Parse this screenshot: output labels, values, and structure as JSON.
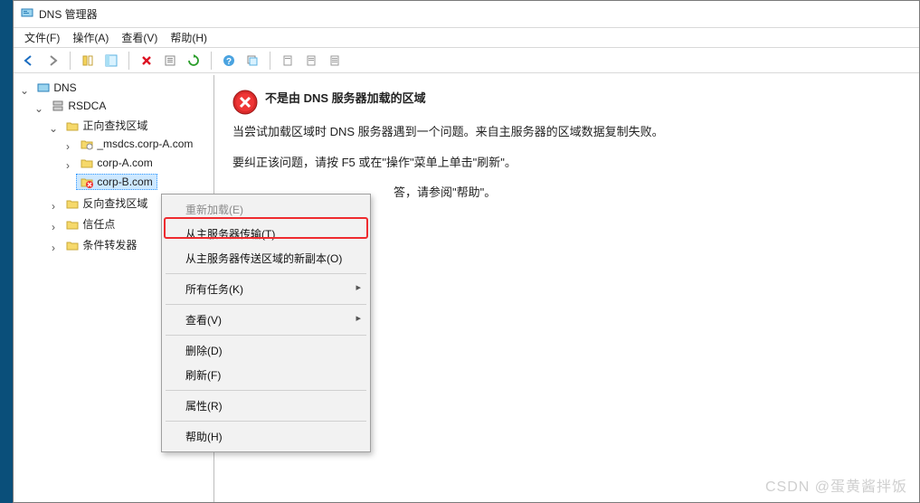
{
  "window": {
    "title": "DNS 管理器"
  },
  "menu": {
    "file": "文件(F)",
    "action": "操作(A)",
    "view": "查看(V)",
    "help": "帮助(H)"
  },
  "tree": {
    "root": "DNS",
    "server": "RSDCA",
    "fwd": "正向查找区域",
    "z0": "_msdcs.corp-A.com",
    "z1": "corp-A.com",
    "z2": "corp-B.com",
    "rev": "反向查找区域",
    "trust": "信任点",
    "cond": "条件转发器"
  },
  "content": {
    "title": "不是由 DNS 服务器加载的区域",
    "p1": "当尝试加载区域时 DNS 服务器遇到一个问题。来自主服务器的区域数据复制失败。",
    "p2": "要纠正该问题，请按 F5 或在\"操作\"菜单上单击\"刷新\"。",
    "p3_partial": "答，请参阅\"帮助\"。"
  },
  "ctx": {
    "reload": "重新加载(E)",
    "transfer": "从主服务器传输(T)",
    "newcopy": "从主服务器传送区域的新副本(O)",
    "tasks": "所有任务(K)",
    "view": "查看(V)",
    "delete": "删除(D)",
    "refresh": "刷新(F)",
    "props": "属性(R)",
    "help": "帮助(H)"
  },
  "watermark": "CSDN @蛋黄酱拌饭"
}
